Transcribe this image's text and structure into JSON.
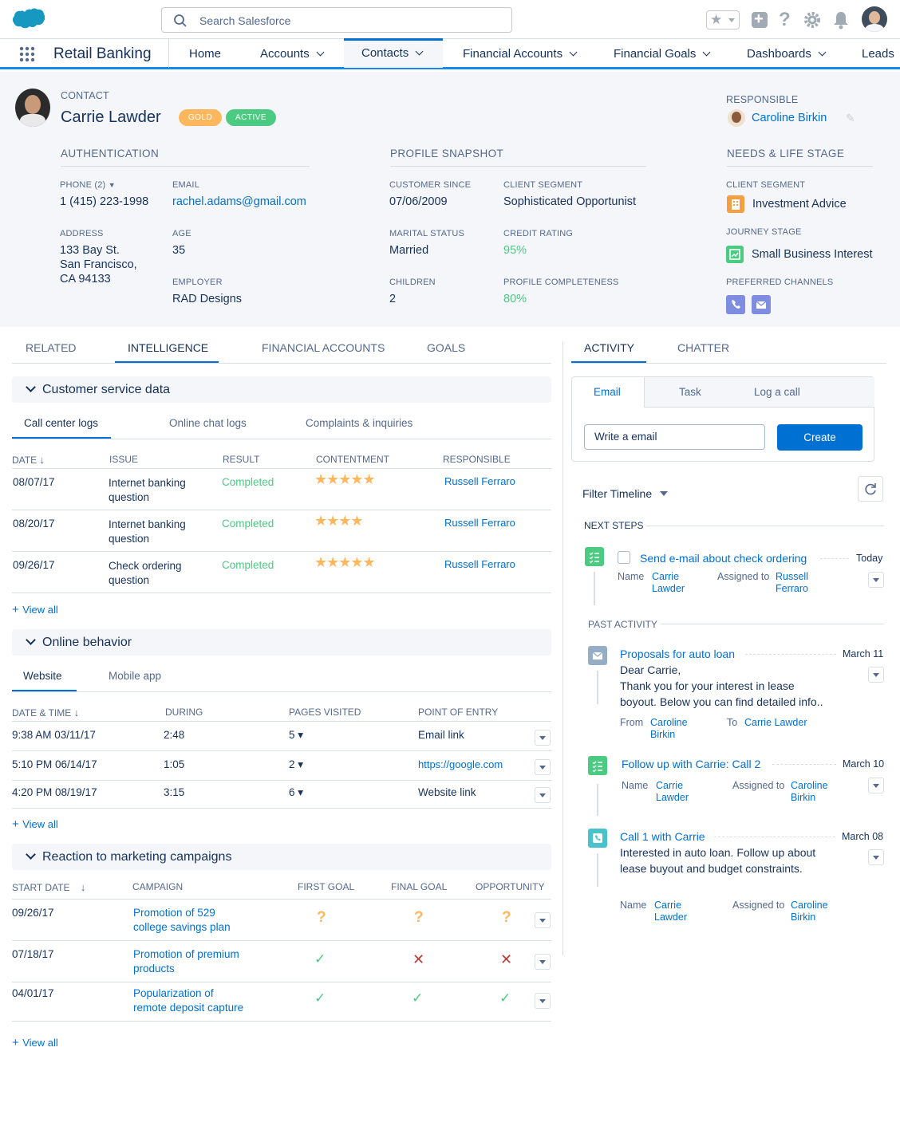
{
  "top": {
    "search_placeholder": "Search Salesforce"
  },
  "nav": {
    "app_name": "Retail Banking",
    "items": [
      {
        "label": "Home"
      },
      {
        "label": "Accounts"
      },
      {
        "label": "Contacts"
      },
      {
        "label": "Financial Accounts"
      },
      {
        "label": "Financial Goals"
      },
      {
        "label": "Dashboards"
      },
      {
        "label": "Leads"
      }
    ]
  },
  "contact": {
    "type_label": "CONTACT",
    "name": "Carrie Lawder",
    "badges": [
      "GOLD",
      "ACTIVE"
    ],
    "responsible_label": "RESPONSIBLE",
    "responsible": "Caroline Birkin"
  },
  "auth": {
    "title": "AUTHENTICATION",
    "phone_label": "PHONE (2)",
    "phone": "1 (415) 223-1998",
    "email_label": "EMAIL",
    "email": "rachel.adams@gmail.com",
    "address_label": "ADDRESS",
    "address": [
      "133 Bay St.",
      "San Francisco,",
      "CA 94133"
    ],
    "age_label": "AGE",
    "age": "35",
    "employer_label": "EMPLOYER",
    "employer": "RAD Designs"
  },
  "profile": {
    "title": "PROFILE SNAPSHOT",
    "customer_since_label": "CUSTOMER SINCE",
    "customer_since": "07/06/2009",
    "client_segment_label": "CLIENT SEGMENT",
    "client_segment": "Sophisticated Opportunist",
    "marital_label": "MARITAL STATUS",
    "marital": "Married",
    "credit_label": "CREDIT RATING",
    "credit": "95%",
    "children_label": "CHILDREN",
    "children": "2",
    "completeness_label": "PROFILE COMPLETENESS",
    "completeness": "80%"
  },
  "needs": {
    "title": "NEEDS & LIFE STAGE",
    "segment_label": "CLIENT SEGMENT",
    "segment": "Investment Advice",
    "journey_label": "JOURNEY STAGE",
    "journey": "Small Business Interest",
    "channels_label": "PREFERRED CHANNELS"
  },
  "left_tabs": [
    "RELATED",
    "INTELLIGENCE",
    "FINANCIAL ACCOUNTS",
    "GOALS"
  ],
  "customer_service": {
    "title": "Customer service data",
    "subtabs": [
      "Call center logs",
      "Online chat logs",
      "Complaints & inquiries"
    ],
    "headers": [
      "DATE",
      "ISSUE",
      "RESULT",
      "CONTENTMENT",
      "RESPONSIBLE"
    ],
    "rows": [
      {
        "date": "08/07/17",
        "issue": "Internet banking question",
        "result": "Completed",
        "stars": 5,
        "responsible": "Russell Ferraro"
      },
      {
        "date": "08/20/17",
        "issue": "Internet banking question",
        "result": "Completed",
        "stars": 4,
        "responsible": "Russell Ferraro"
      },
      {
        "date": "09/26/17",
        "issue": "Check ordering question",
        "result": "Completed",
        "stars": 5,
        "responsible": "Russell Ferraro"
      }
    ],
    "view_all": "View all"
  },
  "online": {
    "title": "Online behavior",
    "subtabs": [
      "Website",
      "Mobile app"
    ],
    "headers": [
      "DATE & TIME",
      "DURING",
      "PAGES VISITED",
      "POINT OF ENTRY"
    ],
    "rows": [
      {
        "datetime": "9:38 AM 03/11/17",
        "during": "2:48",
        "pages": "5",
        "entry": "Email link"
      },
      {
        "datetime": "5:10 PM 06/14/17",
        "during": "1:05",
        "pages": "2",
        "entry": "https://google.com"
      },
      {
        "datetime": "4:20 PM 08/19/17",
        "during": "3:15",
        "pages": "6",
        "entry": "Website link"
      }
    ],
    "view_all": "View all"
  },
  "marketing": {
    "title": "Reaction to marketing campaigns",
    "headers": [
      "START DATE",
      "CAMPAIGN",
      "FIRST GOAL",
      "FINAL GOAL",
      "OPPORTUNITY"
    ],
    "rows": [
      {
        "date": "09/26/17",
        "campaign": "Promotion of 529 college savings plan",
        "marks": [
          "?",
          "?",
          "?"
        ]
      },
      {
        "date": "07/18/17",
        "campaign": "Promotion of premium products",
        "marks": [
          "check",
          "x",
          "x"
        ]
      },
      {
        "date": "04/01/17",
        "campaign": "Popularization of remote deposit capture",
        "marks": [
          "check",
          "check",
          "check"
        ]
      }
    ],
    "view_all": "View all"
  },
  "right_tabs": [
    "ACTIVITY",
    "CHATTER"
  ],
  "composer": {
    "tabs": [
      "Email",
      "Task",
      "Log a call"
    ],
    "placeholder": "Write a email",
    "create": "Create"
  },
  "timeline": {
    "filter": "Filter Timeline",
    "next_steps": "NEXT STEPS",
    "past_activity": "PAST ACTIVITY",
    "next": {
      "title": "Send e-mail about check ordering",
      "date": "Today",
      "name_label": "Name",
      "name": "Carrie Lawder",
      "assigned_label": "Assigned to",
      "assigned": "Russell Ferraro"
    },
    "past": [
      {
        "title": "Proposals for auto loan",
        "date": "March 11",
        "body": [
          "Dear Carrie,",
          "Thank you for your interest in lease",
          "boyout. Below you can find detailed info.."
        ],
        "k1": "From",
        "v1": "Caroline Birkin",
        "k2": "To",
        "v2": "Carrie Lawder"
      },
      {
        "title": "Follow up with Carrie: Call 2",
        "date": "March 10",
        "k1": "Name",
        "v1": "Carrie Lawder",
        "k2": "Assigned to",
        "v2": "Caroline Birkin"
      },
      {
        "title": "Call 1 with Carrie",
        "date": "March 08",
        "body": [
          "Interested in auto loan. Follow up about",
          "lease buyout and budget constraints."
        ],
        "k1": "Name",
        "v1": "Carrie Lawder",
        "k2": "Assigned to",
        "v2": "Caroline Birkin"
      }
    ]
  },
  "colors": {
    "brand": "#0070d2",
    "accent_blue": "#1589ee",
    "gold": "#ffb75d",
    "green": "#4bca81",
    "red": "#c23934"
  }
}
